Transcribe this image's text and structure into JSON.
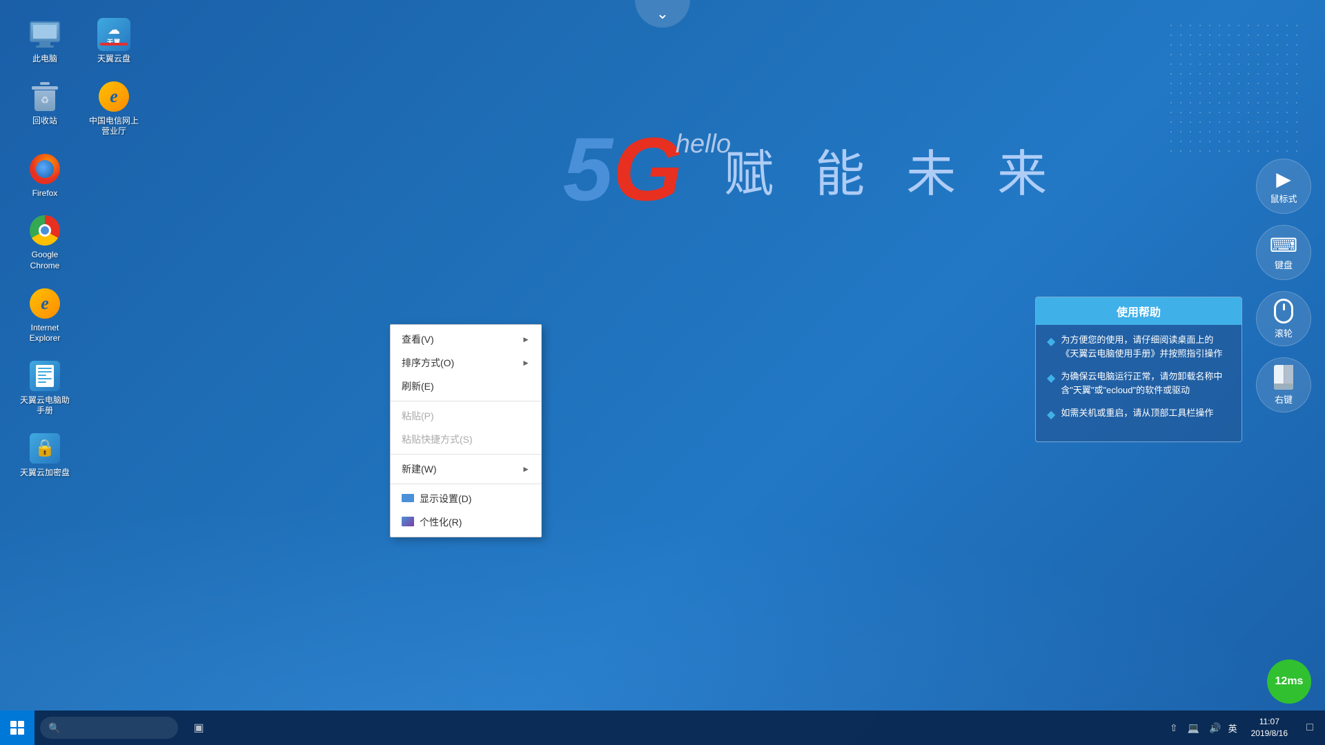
{
  "desktop": {
    "background_color": "#1a5fa8"
  },
  "icons": [
    {
      "id": "this-pc",
      "label": "此电脑",
      "type": "pc"
    },
    {
      "id": "tianyi-cloud",
      "label": "天翼云盘",
      "type": "cloud"
    },
    {
      "id": "recycle-bin",
      "label": "回收站",
      "type": "recycle"
    },
    {
      "id": "china-telecom",
      "label": "中国电信网上营业厅",
      "type": "ie"
    },
    {
      "id": "firefox",
      "label": "Firefox",
      "type": "firefox"
    },
    {
      "id": "google-chrome",
      "label": "Google Chrome",
      "type": "chrome"
    },
    {
      "id": "internet-explorer",
      "label": "Internet Explorer",
      "type": "ie2"
    },
    {
      "id": "tianyi-manual",
      "label": "天翼云电脑助手册",
      "type": "manual"
    },
    {
      "id": "tianyi-encrypt",
      "label": "天翼云加密盘",
      "type": "encrypt"
    }
  ],
  "branding": {
    "num": "5",
    "letter": "G",
    "hello": "hello",
    "slogan": "赋 能 未 来"
  },
  "context_menu": {
    "items": [
      {
        "label": "查看(V)",
        "has_arrow": true,
        "disabled": false
      },
      {
        "label": "排序方式(O)",
        "has_arrow": true,
        "disabled": false
      },
      {
        "label": "刷新(E)",
        "has_arrow": false,
        "disabled": false
      },
      {
        "label": "粘贴(P)",
        "has_arrow": false,
        "disabled": true
      },
      {
        "label": "粘贴快捷方式(S)",
        "has_arrow": false,
        "disabled": true
      },
      {
        "label": "新建(W)",
        "has_arrow": true,
        "disabled": false
      },
      {
        "label": "显示设置(D)",
        "has_arrow": false,
        "disabled": false,
        "icon": "monitor"
      },
      {
        "label": "个性化(R)",
        "has_arrow": false,
        "disabled": false,
        "icon": "personalize"
      }
    ]
  },
  "help_panel": {
    "title": "使用帮助",
    "items": [
      "为方便您的使用，请仔细阅读桌面上的《天翼云电脑使用手册》并按照指引操作",
      "为确保云电脑运行正常，请勿卸载名称中含\"天翼\"或\"ecloud\"的软件或驱动",
      "如需关机或重启，请从顶部工具栏操作"
    ]
  },
  "right_buttons": [
    {
      "id": "mouse-btn",
      "label": "鼠标式",
      "icon": "cursor"
    },
    {
      "id": "keyboard-btn",
      "label": "键盘",
      "icon": "keyboard"
    },
    {
      "id": "scroll-btn",
      "label": "滚轮",
      "icon": "scroll"
    },
    {
      "id": "right-key-btn",
      "label": "右键",
      "icon": "rightclick"
    }
  ],
  "taskbar": {
    "search_placeholder": "搜索",
    "tray_lang": "英",
    "clock_time": "11:07",
    "clock_date": "2019/8/16"
  },
  "latency": {
    "value": "12ms"
  }
}
